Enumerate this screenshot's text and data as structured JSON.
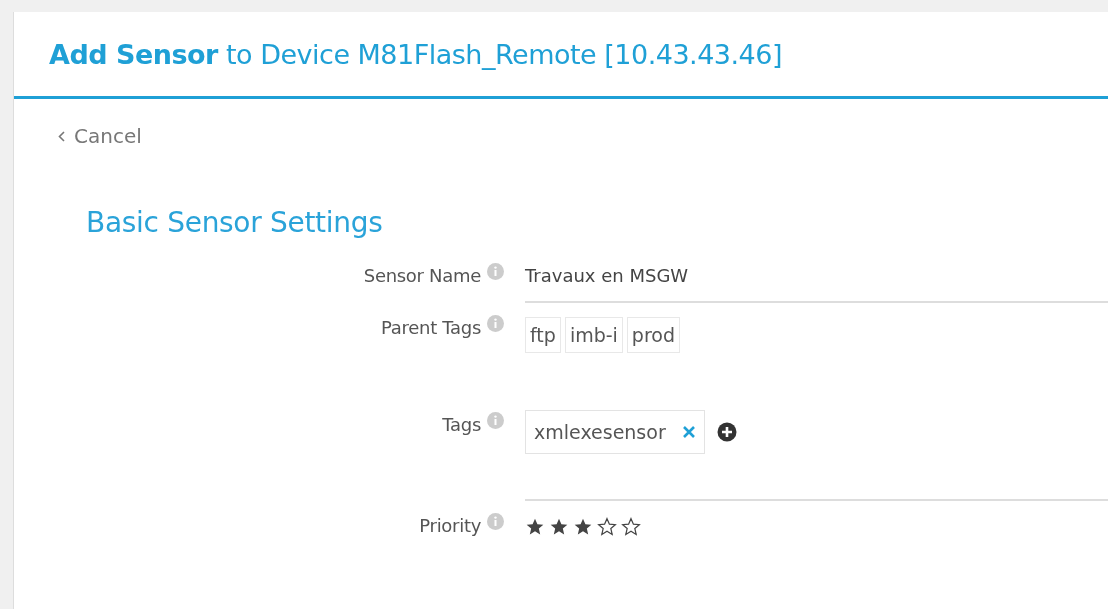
{
  "header": {
    "title_bold": "Add Sensor",
    "title_rest": "to Device M81Flash_Remote [10.43.43.46]"
  },
  "cancel": {
    "label": "Cancel"
  },
  "section": {
    "title": "Basic Sensor Settings"
  },
  "fields": [
    {
      "kind": "text",
      "label": "Sensor Name",
      "value": "Travaux en MSGW"
    },
    {
      "kind": "parent_tags",
      "label": "Parent Tags",
      "tags": [
        "ftp",
        "imb-i",
        "prod"
      ]
    },
    {
      "kind": "tags",
      "label": "Tags",
      "tags": [
        "xmlexesensor"
      ]
    },
    {
      "kind": "priority",
      "label": "Priority",
      "stars": 3
    }
  ]
}
